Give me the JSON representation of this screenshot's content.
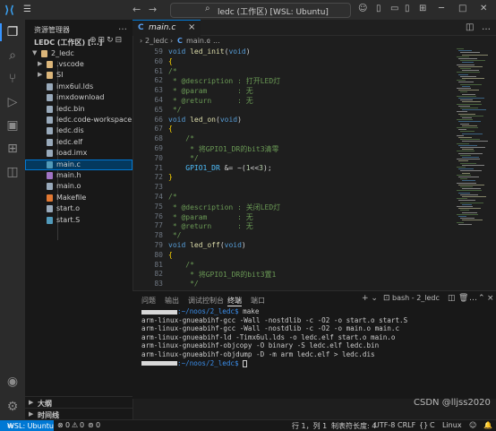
{
  "titlebar": {
    "menu_icon": "hamburger-icon",
    "search_text": "ledc (工作区) [WSL: Ubuntu]",
    "colors": {
      "accent": "#0078d4"
    }
  },
  "sidebar": {
    "header": "资源管理器",
    "workspace": "LEDC (工作区) [...]",
    "root_folder": "2_ledc",
    "items": [
      {
        "label": ".vscode",
        "type": "folder"
      },
      {
        "label": "SI",
        "type": "folder"
      },
      {
        "label": "imx6ul.lds",
        "type": "file"
      },
      {
        "label": "imxdownload",
        "type": "file"
      },
      {
        "label": "ledc.bin",
        "type": "file"
      },
      {
        "label": "ledc.code-workspace",
        "type": "file"
      },
      {
        "label": "ledc.dis",
        "type": "file"
      },
      {
        "label": "ledc.elf",
        "type": "file"
      },
      {
        "label": "load.imx",
        "type": "file"
      },
      {
        "label": "main.c",
        "type": "c"
      },
      {
        "label": "main.h",
        "type": "h"
      },
      {
        "label": "main.o",
        "type": "file"
      },
      {
        "label": "Makefile",
        "type": "make"
      },
      {
        "label": "start.o",
        "type": "file"
      },
      {
        "label": "start.S",
        "type": "asm"
      }
    ],
    "outline": "大纲",
    "timeline": "时间线"
  },
  "editor": {
    "tab_label": "main.c",
    "breadcrumb": [
      "2_ledc",
      "main.c",
      "..."
    ],
    "lines": [
      {
        "n": "59",
        "t": "void led_init(void)"
      },
      {
        "n": "60",
        "t": "{"
      },
      {
        "n": "61",
        "t": "/*"
      },
      {
        "n": "62",
        "t": " * @description : 打开LED灯"
      },
      {
        "n": "63",
        "t": " * @param       : 无"
      },
      {
        "n": "64",
        "t": " * @return      : 无"
      },
      {
        "n": "65",
        "t": " */"
      },
      {
        "n": "66",
        "t": "void led_on(void)"
      },
      {
        "n": "67",
        "t": "{"
      },
      {
        "n": "68",
        "t": "    /*"
      },
      {
        "n": "69",
        "t": "     * 将GPIO1_DR的bit3清零"
      },
      {
        "n": "70",
        "t": "     */"
      },
      {
        "n": "71",
        "t": "    GPIO1_DR &= ~(1<<3);"
      },
      {
        "n": "72",
        "t": "}"
      },
      {
        "n": "73",
        "t": ""
      },
      {
        "n": "74",
        "t": "/*"
      },
      {
        "n": "75",
        "t": " * @description : 关闭LED灯"
      },
      {
        "n": "76",
        "t": " * @param       : 无"
      },
      {
        "n": "77",
        "t": " * @return      : 无"
      },
      {
        "n": "78",
        "t": " */"
      },
      {
        "n": "79",
        "t": "void led_off(void)"
      },
      {
        "n": "80",
        "t": "{"
      },
      {
        "n": "81",
        "t": "    /*"
      },
      {
        "n": "82",
        "t": "     * 将GPIO1_DR的bit3置1"
      },
      {
        "n": "83",
        "t": "     */"
      }
    ]
  },
  "panel": {
    "tabs": [
      "问题",
      "输出",
      "调试控制台",
      "终端",
      "端口"
    ],
    "active_tab": "终端",
    "terminal_name": "bash - 2_ledc",
    "terminal_lines": [
      {
        "prompt": ":~/noos/2_ledc$",
        "cmd": " make"
      },
      {
        "prompt": "",
        "cmd": "arm-linux-gnueabihf-gcc -Wall -nostdlib -c -O2 -o start.o start.S"
      },
      {
        "prompt": "",
        "cmd": "arm-linux-gnueabihf-gcc -Wall -nostdlib -c -O2 -o main.o main.c"
      },
      {
        "prompt": "",
        "cmd": "arm-linux-gnueabihf-ld -Timx6ul.lds -o ledc.elf start.o main.o"
      },
      {
        "prompt": "",
        "cmd": "arm-linux-gnueabihf-objcopy -O binary -S ledc.elf ledc.bin"
      },
      {
        "prompt": "",
        "cmd": "arm-linux-gnueabihf-objdump -D -m arm ledc.elf > ledc.dis"
      },
      {
        "prompt": ":~/noos/2_ledc$",
        "cmd": " "
      }
    ]
  },
  "statusbar": {
    "remote": "WSL: Ubuntu",
    "errors": "0",
    "warnings": "0",
    "ports": "0",
    "position": "行 1，列 1",
    "indent": "制表符长度: 4",
    "encoding": "UTF-8",
    "eol": "CRLF",
    "language": "C",
    "platform": "Linux"
  },
  "watermark": "CSDN @lljss2020"
}
